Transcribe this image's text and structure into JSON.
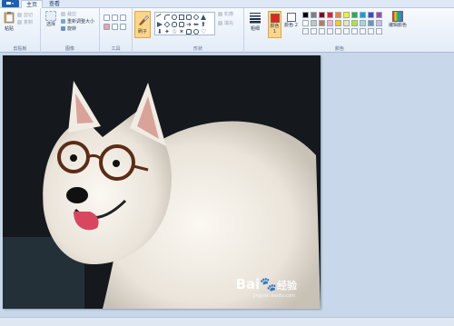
{
  "tabs": {
    "file_menu": "file-menu",
    "home": "主页",
    "view": "查看"
  },
  "clipboard": {
    "paste": "粘贴",
    "cut": "剪切",
    "copy": "复制",
    "group_label": "剪贴板"
  },
  "image": {
    "select": "选择",
    "crop": "裁剪",
    "resize": "重新调整大小",
    "rotate": "旋转",
    "group_label": "图像"
  },
  "tools": {
    "group_label": "工具"
  },
  "brush": {
    "label": "刷子"
  },
  "shapes": {
    "outline": "轮廓",
    "fill": "填充",
    "group_label": "形状"
  },
  "size": {
    "label": "粗细"
  },
  "colors": {
    "color1_label": "颜色 1",
    "color2_label": "颜色 2",
    "edit_label": "编辑颜色",
    "group_label": "颜色",
    "color1": "#e8231c",
    "color2": "#ffffff",
    "palette": [
      "#000000",
      "#7f7f7f",
      "#880015",
      "#ed1c24",
      "#ff7f27",
      "#fff200",
      "#22b14c",
      "#00a2e8",
      "#3f48cc",
      "#a349a4",
      "#ffffff",
      "#c3c3c3",
      "#b97a57",
      "#ffaec9",
      "#ffc90e",
      "#efe4b0",
      "#b5e61d",
      "#99d9ea",
      "#7092be",
      "#c8bfe7"
    ]
  },
  "watermark": {
    "brand": "Bai",
    "brand2": "经验",
    "domain": "jingyan.baidu.com"
  }
}
